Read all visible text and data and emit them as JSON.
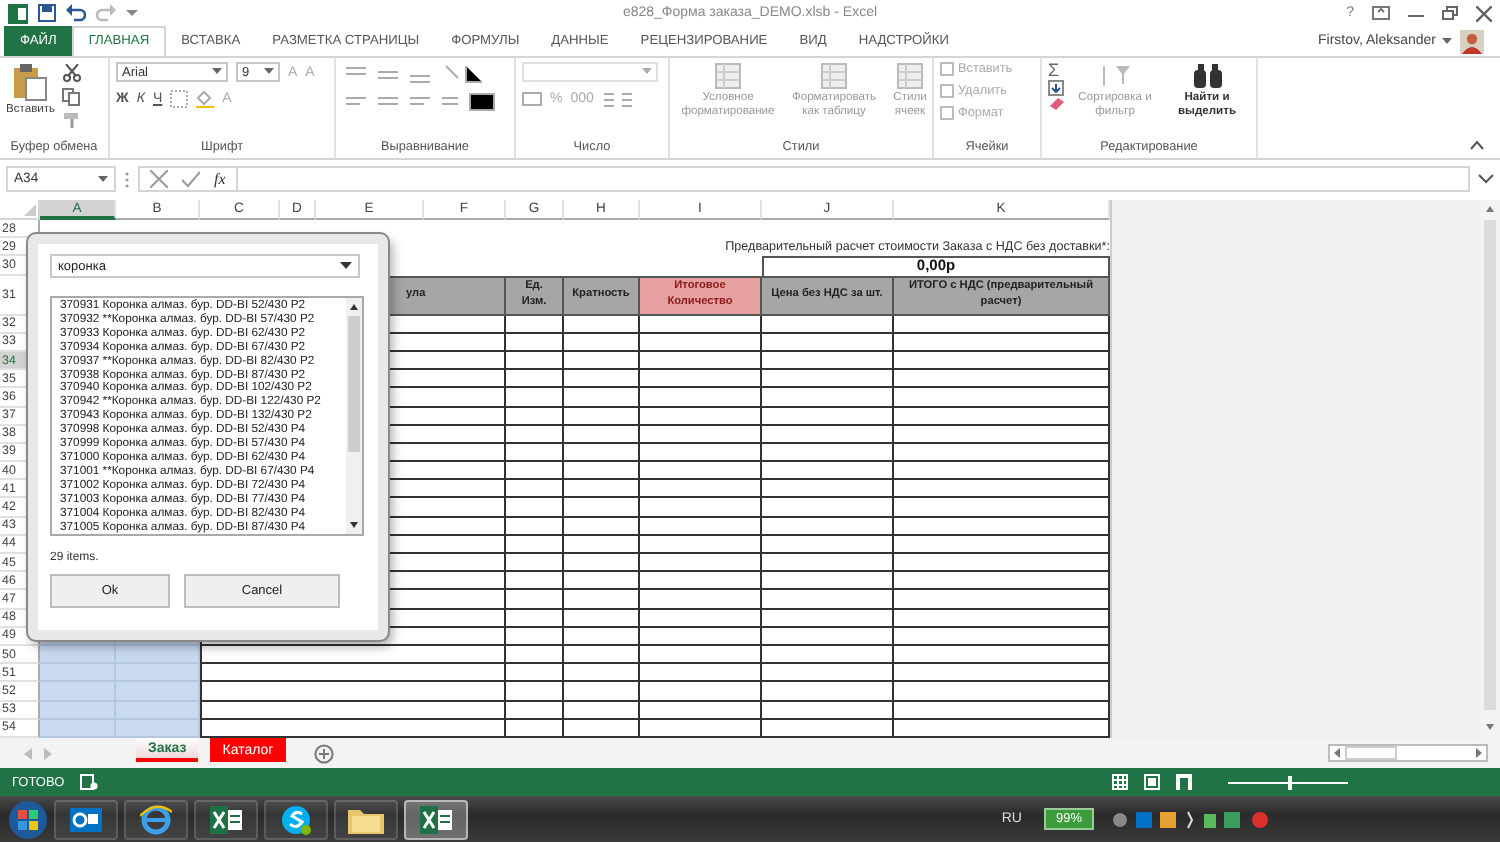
{
  "window": {
    "title": "e828_Форма заказа_DEMO.xlsb - Excel",
    "help": "?",
    "user": "Firstov, Aleksander"
  },
  "ribbon_tabs": [
    {
      "label": "ФАЙЛ",
      "kind": "file",
      "selected": false
    },
    {
      "label": "ГЛАВНАЯ",
      "kind": "tab",
      "selected": true
    },
    {
      "label": "ВСТАВКА",
      "kind": "tab",
      "selected": false
    },
    {
      "label": "РАЗМЕТКА СТРАНИЦЫ",
      "kind": "tab",
      "selected": false
    },
    {
      "label": "ФОРМУЛЫ",
      "kind": "tab",
      "selected": false
    },
    {
      "label": "ДАННЫЕ",
      "kind": "tab",
      "selected": false
    },
    {
      "label": "РЕЦЕНЗИРОВАНИЕ",
      "kind": "tab",
      "selected": false
    },
    {
      "label": "ВИД",
      "kind": "tab",
      "selected": false
    },
    {
      "label": "НАДСТРОЙКИ",
      "kind": "tab",
      "selected": false
    }
  ],
  "clipboard": {
    "paste": "Вставить",
    "group": "Буфер обмена"
  },
  "font": {
    "name": "Arial",
    "size": "9",
    "grow": [
      "A",
      "A"
    ],
    "styles": [
      "Ж",
      "К",
      "Ч"
    ],
    "color_letter": "A",
    "group": "Шрифт"
  },
  "alignment": {
    "group": "Выравнивание"
  },
  "number": {
    "buttons": [
      "%",
      "000"
    ],
    "group": "Число"
  },
  "styles": {
    "buttons": [
      "Условное форматирование",
      "Форматировать как таблицу",
      "Стили ячеек"
    ],
    "group": "Стили"
  },
  "cells": {
    "buttons": [
      "Вставить",
      "Удалить",
      "Формат"
    ],
    "group": "Ячейки"
  },
  "editing": {
    "sum": "Σ",
    "buttons": [
      "Сортировка и фильтр",
      "Найти и выделить"
    ],
    "group": "Редактирование"
  },
  "formula_bar": {
    "name_box": "A34",
    "fx": "fx"
  },
  "columns": [
    {
      "label": "A",
      "selected": true
    },
    {
      "label": "B",
      "selected": false
    },
    {
      "label": "C",
      "selected": false
    },
    {
      "label": "D",
      "selected": false
    },
    {
      "label": "E",
      "selected": false
    },
    {
      "label": "F",
      "selected": false
    },
    {
      "label": "G",
      "selected": false
    },
    {
      "label": "H",
      "selected": false
    },
    {
      "label": "I",
      "selected": false
    },
    {
      "label": "J",
      "selected": false
    },
    {
      "label": "K",
      "selected": false
    }
  ],
  "rows": [
    {
      "label": "28",
      "kind": "blank",
      "selected": false
    },
    {
      "label": "29",
      "kind": "note",
      "selected": false
    },
    {
      "label": "30",
      "kind": "total",
      "selected": false
    },
    {
      "label": "31",
      "kind": "header",
      "selected": false
    },
    {
      "label": "32",
      "kind": "body",
      "selected": false
    },
    {
      "label": "33",
      "kind": "body",
      "selected": false
    },
    {
      "label": "34",
      "kind": "body",
      "selected": true
    },
    {
      "label": "35",
      "kind": "body",
      "selected": false
    },
    {
      "label": "36",
      "kind": "body",
      "selected": false
    },
    {
      "label": "37",
      "kind": "body",
      "selected": false
    },
    {
      "label": "38",
      "kind": "body",
      "selected": false
    },
    {
      "label": "39",
      "kind": "body",
      "selected": false
    },
    {
      "label": "40",
      "kind": "body",
      "selected": false
    },
    {
      "label": "41",
      "kind": "body",
      "selected": false
    },
    {
      "label": "42",
      "kind": "body",
      "selected": false
    },
    {
      "label": "43",
      "kind": "body",
      "selected": false
    },
    {
      "label": "44",
      "kind": "body",
      "selected": false
    },
    {
      "label": "45",
      "kind": "body",
      "selected": false
    },
    {
      "label": "46",
      "kind": "body",
      "selected": false
    },
    {
      "label": "47",
      "kind": "body",
      "selected": false
    },
    {
      "label": "48",
      "kind": "body",
      "selected": false
    },
    {
      "label": "49",
      "kind": "body",
      "selected": false
    },
    {
      "label": "50",
      "kind": "body",
      "selected": false
    },
    {
      "label": "51",
      "kind": "body",
      "selected": false
    },
    {
      "label": "52",
      "kind": "body",
      "selected": false
    },
    {
      "label": "53",
      "kind": "body",
      "selected": false
    },
    {
      "label": "54",
      "kind": "body",
      "selected": false
    }
  ],
  "sheet": {
    "note": "Предварительный расчет стоимости Заказа с НДС без доставки*:",
    "total": "0,00р",
    "header": [
      {
        "label": "ула",
        "kind": "gray"
      },
      {
        "label": "Ед. Изм.",
        "kind": "gray"
      },
      {
        "label": "Кратность",
        "kind": "gray"
      },
      {
        "label": "Итоговое Количество",
        "kind": "pink"
      },
      {
        "label": "Цена без НДС за шт.",
        "kind": "gray"
      },
      {
        "label": "ИТОГО с НДС (предварительный расчет)",
        "kind": "gray"
      }
    ]
  },
  "dialog": {
    "search": "коронка",
    "items": [
      "370931 Коронка алмаз. бур. DD-BI 52/430 P2",
      "370932 **Коронка алмаз. бур. DD-BI 57/430 P2",
      "370933 Коронка алмаз. бур. DD-BI 62/430 P2",
      "370934 Коронка алмаз. бур. DD-BI 67/430 P2",
      "370937 **Коронка алмаз. бур. DD-BI 82/430 P2",
      "370938 Коронка алмаз. бур. DD-BI 87/430 P2",
      "370940 Коронка алмаз. бур. DD-BI 102/430 P2",
      "370942 **Коронка алмаз. бур. DD-BI 122/430 P2",
      "370943 Коронка алмаз. бур. DD-BI 132/430 P2",
      "370998 Коронка алмаз. бур. DD-BI 52/430 P4",
      "370999 Коронка алмаз. бур. DD-BI 57/430 P4",
      "371000 Коронка алмаз. бур. DD-BI 62/430 P4",
      "371001 **Коронка алмаз. бур. DD-BI 67/430 P4",
      "371002 Коронка алмаз. бур. DD-BI 72/430 P4",
      "371003 Коронка алмаз. бур. DD-BI 77/430 P4",
      "371004 Коронка алмаз. бур. DD-BI 82/430 P4",
      "371005 Коронка алмаз. бур. DD-BI 87/430 P4"
    ],
    "count": "29 items.",
    "buttons": [
      "Ok",
      "Cancel"
    ]
  },
  "sheet_tabs": [
    {
      "label": "Заказ",
      "selected": true,
      "color": "#ff0000"
    },
    {
      "label": "Каталог",
      "selected": false,
      "color": "#ff0000"
    }
  ],
  "status_bar": {
    "status": "ГОТОВО",
    "zoom": {
      "level": 0.5
    }
  },
  "taskbar": {
    "apps": [
      {
        "kind": "outlook",
        "active": false
      },
      {
        "kind": "browser",
        "active": false
      },
      {
        "kind": "excel",
        "active": false
      },
      {
        "kind": "skype",
        "active": false
      },
      {
        "kind": "folder",
        "active": false
      },
      {
        "kind": "excel",
        "active": true
      }
    ],
    "language": "RU",
    "battery": "99%"
  }
}
